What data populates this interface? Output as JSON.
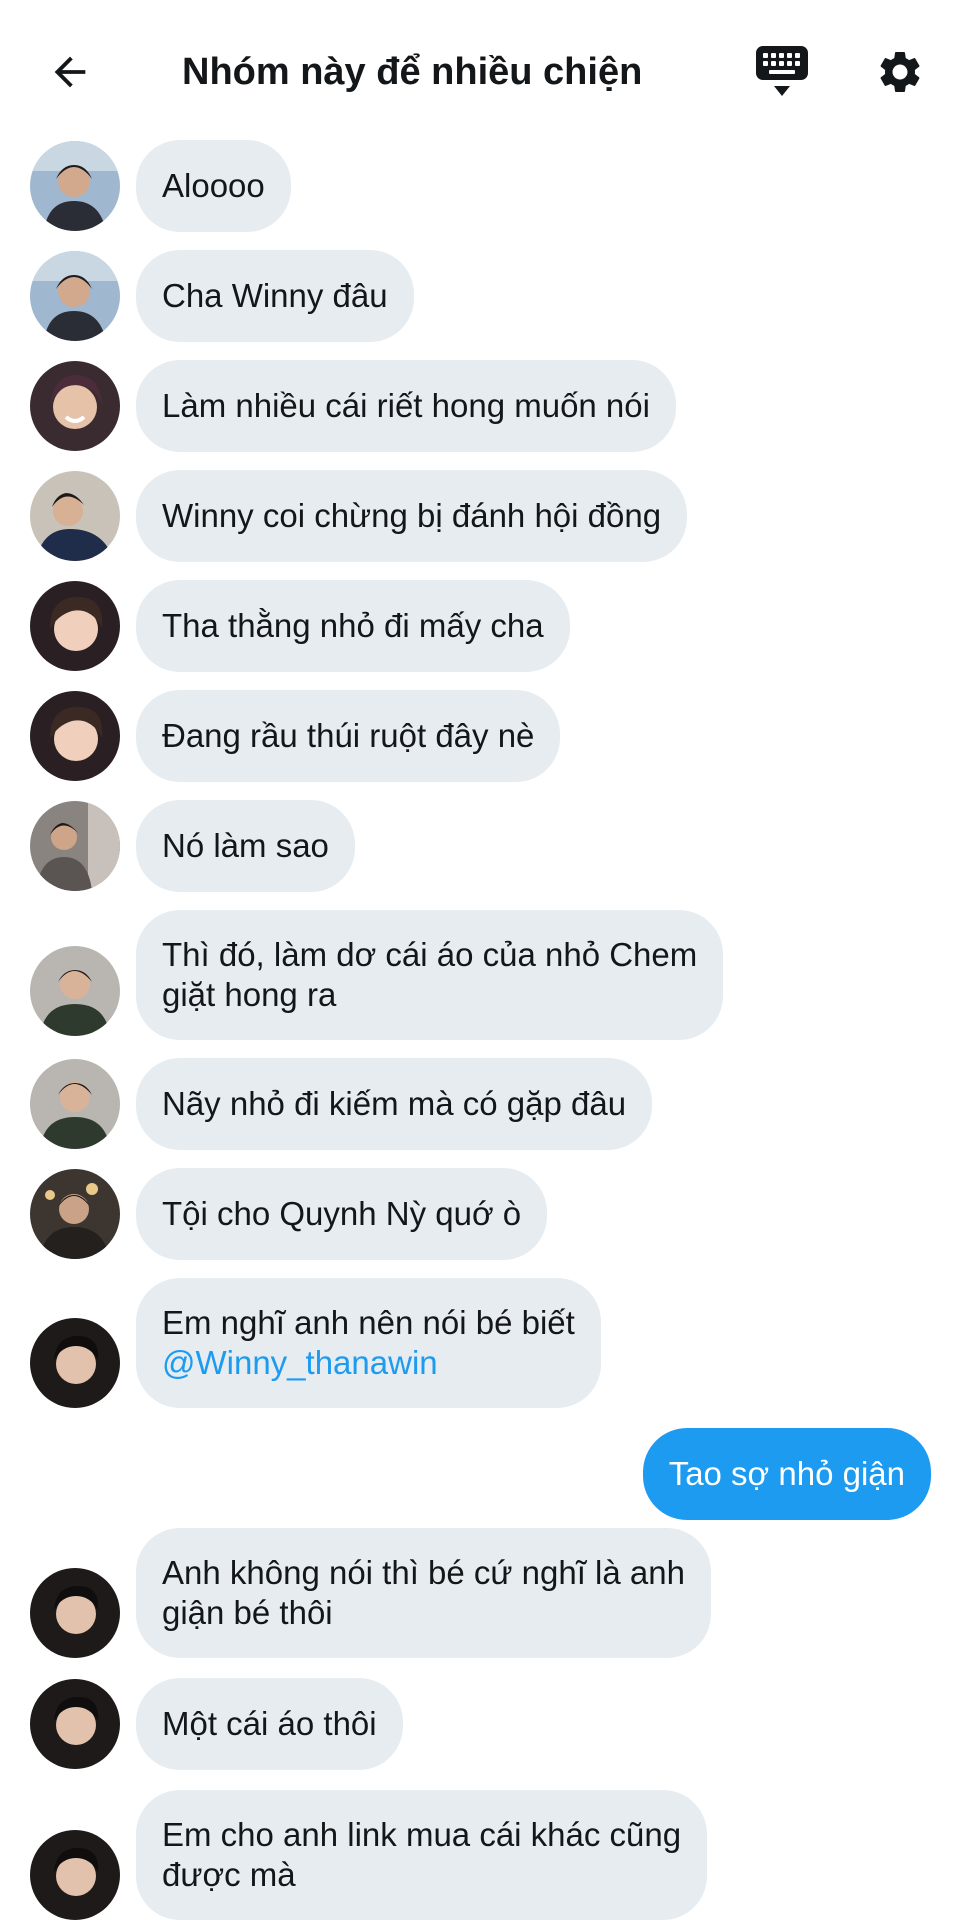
{
  "header": {
    "title": "Nhóm này để nhiều chiện"
  },
  "colors": {
    "bubble_other": "#e6ecf0",
    "bubble_mine": "#1d9bf0",
    "mention": "#1d9bf0",
    "text": "#14171a"
  },
  "icons": {
    "back": "arrow-left-icon",
    "keyboard": "keyboard-icon",
    "settings": "gear-icon"
  },
  "messages": [
    {
      "sender": "other",
      "lines": [
        "Aloooo"
      ]
    },
    {
      "sender": "other",
      "lines": [
        "Cha Winny đâu"
      ]
    },
    {
      "sender": "other",
      "lines": [
        "Làm nhiều cái riết hong muốn nói"
      ]
    },
    {
      "sender": "other",
      "lines": [
        "Winny coi chừng bị đánh hội đồng"
      ]
    },
    {
      "sender": "other",
      "lines": [
        "Tha thằng nhỏ đi mấy cha"
      ]
    },
    {
      "sender": "other",
      "lines": [
        "Đang rầu thúi ruột đây nè"
      ]
    },
    {
      "sender": "other",
      "lines": [
        "Nó làm sao"
      ]
    },
    {
      "sender": "other",
      "lines": [
        "Thì đó, làm dơ cái áo của nhỏ Chem",
        "giặt hong ra"
      ]
    },
    {
      "sender": "other",
      "lines": [
        "Nãy nhỏ đi kiếm mà có gặp đâu"
      ]
    },
    {
      "sender": "other",
      "lines": [
        "Tội cho Quynh Nỳ quớ ò"
      ]
    },
    {
      "sender": "other",
      "lines": [
        "Em nghĩ anh nên nói bé biết",
        "@Winny_thanawin"
      ]
    },
    {
      "sender": "me",
      "lines": [
        "Tao sợ nhỏ giận"
      ]
    },
    {
      "sender": "other",
      "lines": [
        "Anh không nói thì bé cứ nghĩ là anh",
        "giận bé thôi"
      ]
    },
    {
      "sender": "other",
      "lines": [
        "Một cái áo thôi"
      ]
    },
    {
      "sender": "other",
      "lines": [
        "Em cho anh link mua cái khác cũng",
        "được mà"
      ]
    }
  ]
}
